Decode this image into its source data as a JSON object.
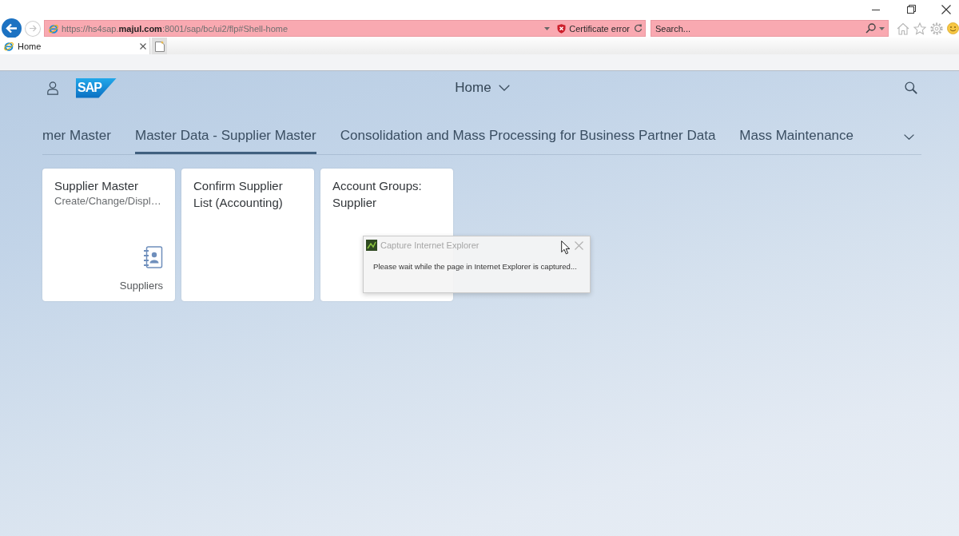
{
  "browser": {
    "address": "https://hs4sap.**majul.com**:8001/sap/bc/ui2/flp#Shell-home",
    "certificate_warning": "Certificate error",
    "search": {
      "placeholder": "Search..."
    },
    "tabs": [
      {
        "label": "Home",
        "selected": true
      }
    ]
  },
  "shell": {
    "logo": "SAP",
    "title": "Home"
  },
  "groups": [
    {
      "label": "mer Master",
      "selected": false
    },
    {
      "label": "Master Data - Supplier Master",
      "selected": true
    },
    {
      "label": "Consolidation and Mass Processing for Business Partner Data",
      "selected": false
    },
    {
      "label": "Mass Maintenance",
      "selected": false
    }
  ],
  "tiles": [
    {
      "kind": "icon",
      "title": "Supplier Master",
      "subtitle": "Create/Change/Displ…",
      "footer": "Suppliers"
    },
    {
      "kind": "text",
      "title": "Confirm Supplier List (Accounting)"
    },
    {
      "kind": "text",
      "title": "Account Groups: Supplier"
    }
  ],
  "dialog": {
    "title": "Capture Internet Explorer",
    "message": "Please wait while the page in Internet Explorer is captured..."
  }
}
